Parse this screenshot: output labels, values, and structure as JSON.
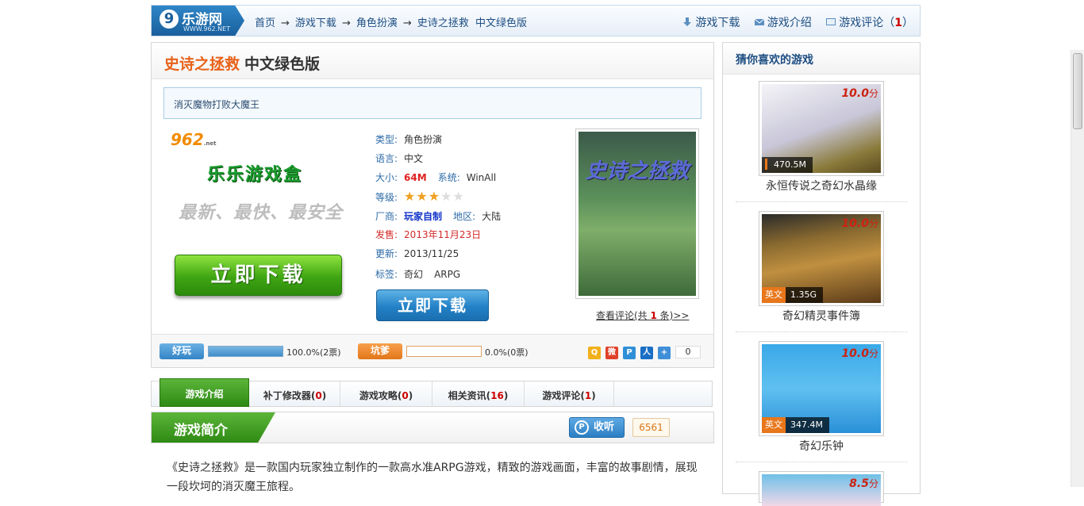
{
  "site": {
    "logo_text": "乐游网",
    "logo_sub": "WWW.962.NET",
    "logo_mark": "9"
  },
  "breadcrumb": [
    "首页",
    "游戏下载",
    "角色扮演",
    "史诗之拯救",
    "中文绿色版"
  ],
  "breadcrumb_arrow": "→",
  "topnav": {
    "download": "游戏下载",
    "intro": "游戏介绍",
    "comments": "游戏评论（",
    "comments_count": "1",
    "comments_close": "）"
  },
  "game": {
    "title": "史诗之拯救",
    "edition": "中文绿色版",
    "summary": "消灭魔物打败大魔王",
    "type_label": "类型:",
    "type": "角色扮演",
    "lang_label": "语言:",
    "lang": "中文",
    "size_label": "大小:",
    "size": "64M",
    "system_label": "系统:",
    "system": "WinAll",
    "level_label": "等级:",
    "stars": 3,
    "stars_max": 5,
    "vendor_label": "厂商:",
    "vendor": "玩家自制",
    "region_label": "地区:",
    "region": "大陆",
    "release_label": "发售:",
    "release": "2013年11月23日",
    "update_label": "更新:",
    "update": "2013/11/25",
    "tags_label": "标签:",
    "tags": [
      "奇幻",
      "ARPG"
    ],
    "download_label": "立即下载",
    "review_link_pre": "查看评论(共 ",
    "review_link_count": "1",
    "review_link_post": " 条)>>",
    "cover_title": "史诗之拯救"
  },
  "promo": {
    "logo": "962",
    "logo_net": ".net",
    "box_name": "乐乐游戏盒",
    "slogan": "最新、最快、最安全",
    "download_label": "立即下载"
  },
  "votes": {
    "good_label": "好玩",
    "good_pct": 100.0,
    "good_text": "100.0%(2票)",
    "bad_label": "坑爹",
    "bad_pct": 0.0,
    "bad_text": "0.0%(0票)",
    "share_count": "0"
  },
  "share_icons": [
    "qzone-icon",
    "weibo-icon",
    "tencent-icon",
    "renren-icon",
    "more-icon"
  ],
  "tabs": [
    {
      "label": "游戏介绍",
      "count": ""
    },
    {
      "label": "补丁修改器",
      "count": "0"
    },
    {
      "label": "游戏攻略",
      "count": "0"
    },
    {
      "label": "相关资讯",
      "count": "16"
    },
    {
      "label": "游戏评论",
      "count": "1"
    }
  ],
  "intro": {
    "heading": "游戏简介",
    "listen_label": "收听",
    "listen_count": "6561",
    "text": "《史诗之拯救》是一款国内玩家独立制作的一款高水准ARPG游戏，精致的游戏画面，丰富的故事剧情，展现一段坎坷的消灭魔王旅程。"
  },
  "sidebar": {
    "title": "猜你喜欢的游戏",
    "items": [
      {
        "name": "永恒传说之奇幻水晶缘",
        "score": "10.0",
        "score_unit": "分",
        "size": "470.5M",
        "lang": ""
      },
      {
        "name": "奇幻精灵事件簿",
        "score": "10.0",
        "score_unit": "分",
        "size": "1.35G",
        "lang": "英文"
      },
      {
        "name": "奇幻乐钟",
        "score": "10.0",
        "score_unit": "分",
        "size": "347.4M",
        "lang": "英文"
      },
      {
        "name": "",
        "score": "8.5",
        "score_unit": "分",
        "size": "",
        "lang": ""
      }
    ]
  },
  "colors": {
    "accent_blue": "#1d4e83",
    "accent_green": "#3fa513",
    "accent_orange": "#e8621a",
    "red": "#e02020"
  }
}
